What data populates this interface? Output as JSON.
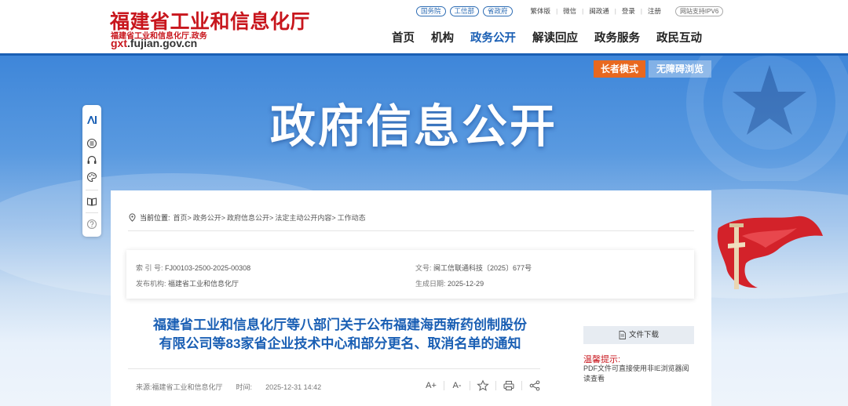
{
  "site": {
    "name": "福建省工业和信息化厅",
    "sub": "福建省工业和信息化厅.政务",
    "domain_prefix": "gxt",
    "domain_rest": ".fujian.gov.cn"
  },
  "top_links": {
    "pills": [
      "国务院",
      "工信部",
      "省政府"
    ],
    "links": [
      "繁体版",
      "微信",
      "闽政通",
      "登录",
      "注册"
    ],
    "ipv6": "网站支持IPV6"
  },
  "nav": {
    "items": [
      "首页",
      "机构",
      "政务公开",
      "解读回应",
      "政务服务",
      "政民互动"
    ],
    "active_index": 2
  },
  "banner": {
    "title": "政府信息公开",
    "elder_mode": "长者模式",
    "accessible": "无障碍浏览"
  },
  "breadcrumb": {
    "label": "当前位置:",
    "items": [
      "首页>",
      "政务公开>",
      "政府信息公开>",
      "法定主动公开内容>",
      "工作动态"
    ]
  },
  "meta": {
    "index_label": "索 引 号:",
    "index_value": "FJ00103-2500-2025-00308",
    "docno_label": "文号:",
    "docno_value": "闽工信联通科技〔2025〕677号",
    "issuer_label": "发布机构:",
    "issuer_value": "福建省工业和信息化厅",
    "date_label": "生成日期:",
    "date_value": "2025-12-29"
  },
  "document": {
    "title_line1": "福建省工业和信息化厅等八部门关于公布福建海西新药创制股份",
    "title_line2": "有限公司等83家省企业技术中心和部分更名、取消名单的通知",
    "source": "来源:福建省工业和信息化厅",
    "time_label": "时间:",
    "time_value": "2025-12-31 14:42",
    "tools": {
      "font_up": "A+",
      "font_down": "A-"
    }
  },
  "sidebar_panel": {
    "download": "文件下载",
    "tip_title": "温馨提示:",
    "tip_body": "PDF文件可直接使用非IE浏览器阅读查看"
  },
  "colors": {
    "brand_red": "#c8161d",
    "brand_blue": "#1a5fb4",
    "elder_orange": "#e8681f"
  }
}
